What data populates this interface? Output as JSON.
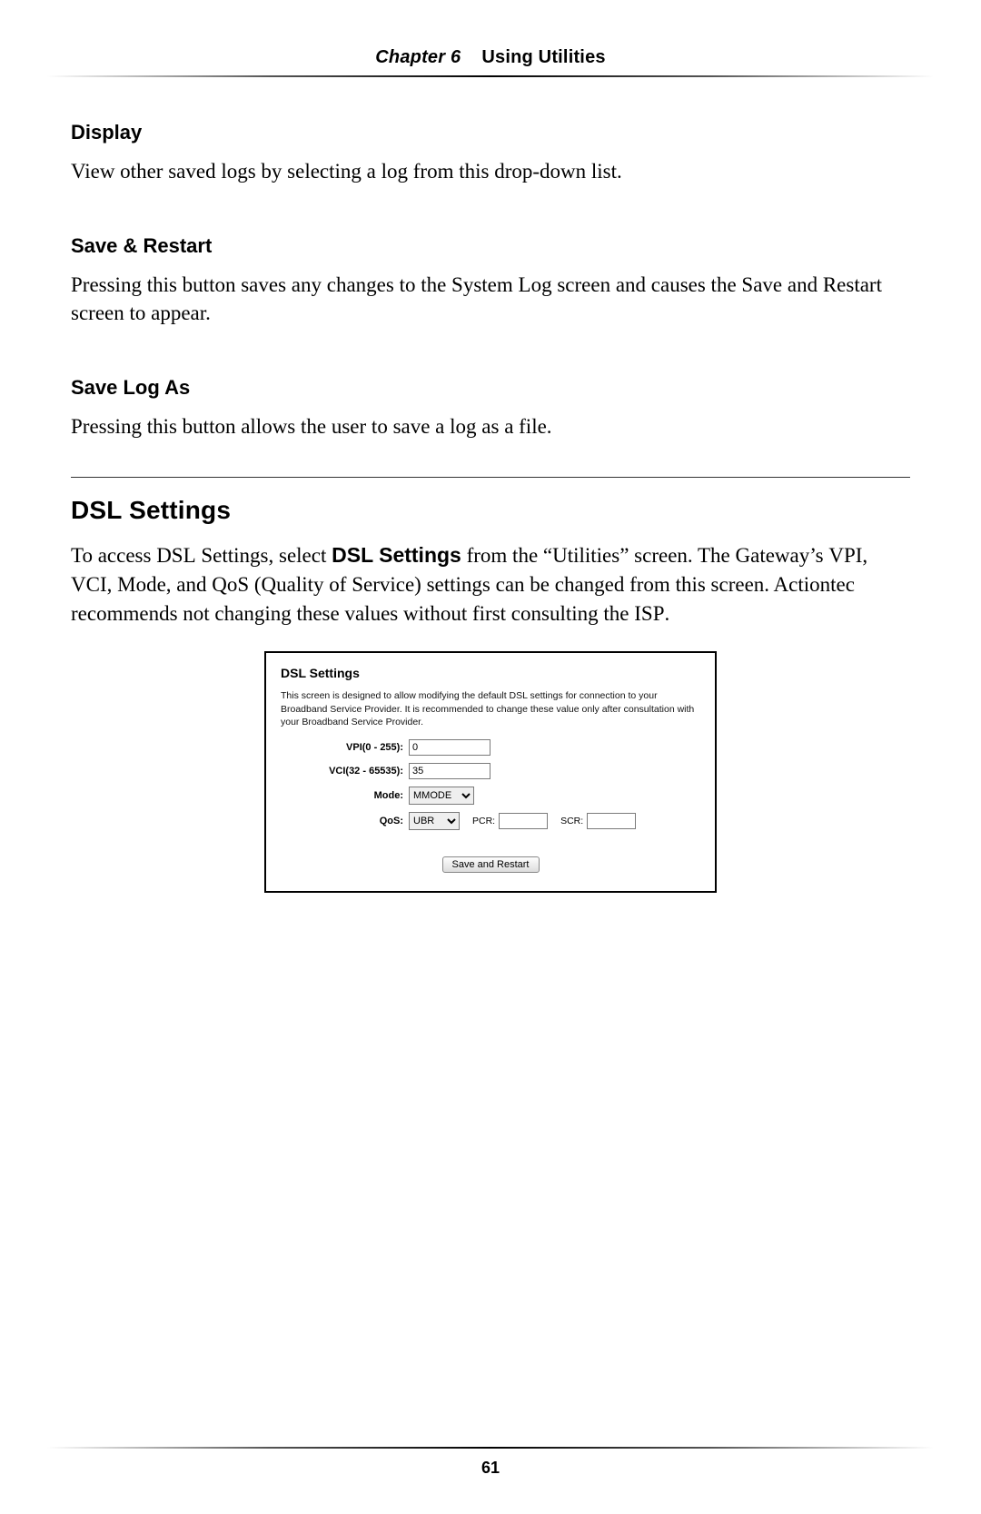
{
  "header": {
    "chapter_label": "Chapter 6",
    "chapter_title": "Using Utilities"
  },
  "sections": {
    "display": {
      "heading": "Display",
      "body": "View other saved logs by selecting a log from this drop-down list."
    },
    "save_restart": {
      "heading": "Save & Restart",
      "body": "Pressing this button saves any changes to the System Log screen and causes the Save and Restart screen to appear."
    },
    "save_log_as": {
      "heading": "Save Log As",
      "body": "Pressing this button allows the user to save a log as a file."
    },
    "dsl": {
      "title": "DSL Settings",
      "intro_prefix": "To access ",
      "intro_dsl": "DSL",
      "intro_mid1": " Settings, select ",
      "intro_bold": "DSL Settings",
      "intro_mid2": " from the “Utilities” screen. The Gateway’s ",
      "intro_vpi": "VPI",
      "intro_sep1": ", ",
      "intro_vci": "VCI",
      "intro_mid3": ", Mode, and QoS (Quality of Service) settings can be changed from this screen. Actiontec recommends not changing these values without first consulting the ",
      "intro_isp": "ISP",
      "intro_end": "."
    }
  },
  "screenshot": {
    "title": "DSL Settings",
    "description": "This screen is designed to allow modifying the default DSL settings for connection to your Broadband Service Provider. It is recommended to change these value only after consultation with your Broadband Service Provider.",
    "fields": {
      "vpi_label": "VPI(0 - 255):",
      "vpi_value": "0",
      "vci_label": "VCI(32 - 65535):",
      "vci_value": "35",
      "mode_label": "Mode:",
      "mode_value": "MMODE",
      "qos_label": "QoS:",
      "qos_value": "UBR",
      "pcr_label": "PCR:",
      "pcr_value": "",
      "scr_label": "SCR:",
      "scr_value": ""
    },
    "button": "Save and Restart"
  },
  "page_number": "61"
}
